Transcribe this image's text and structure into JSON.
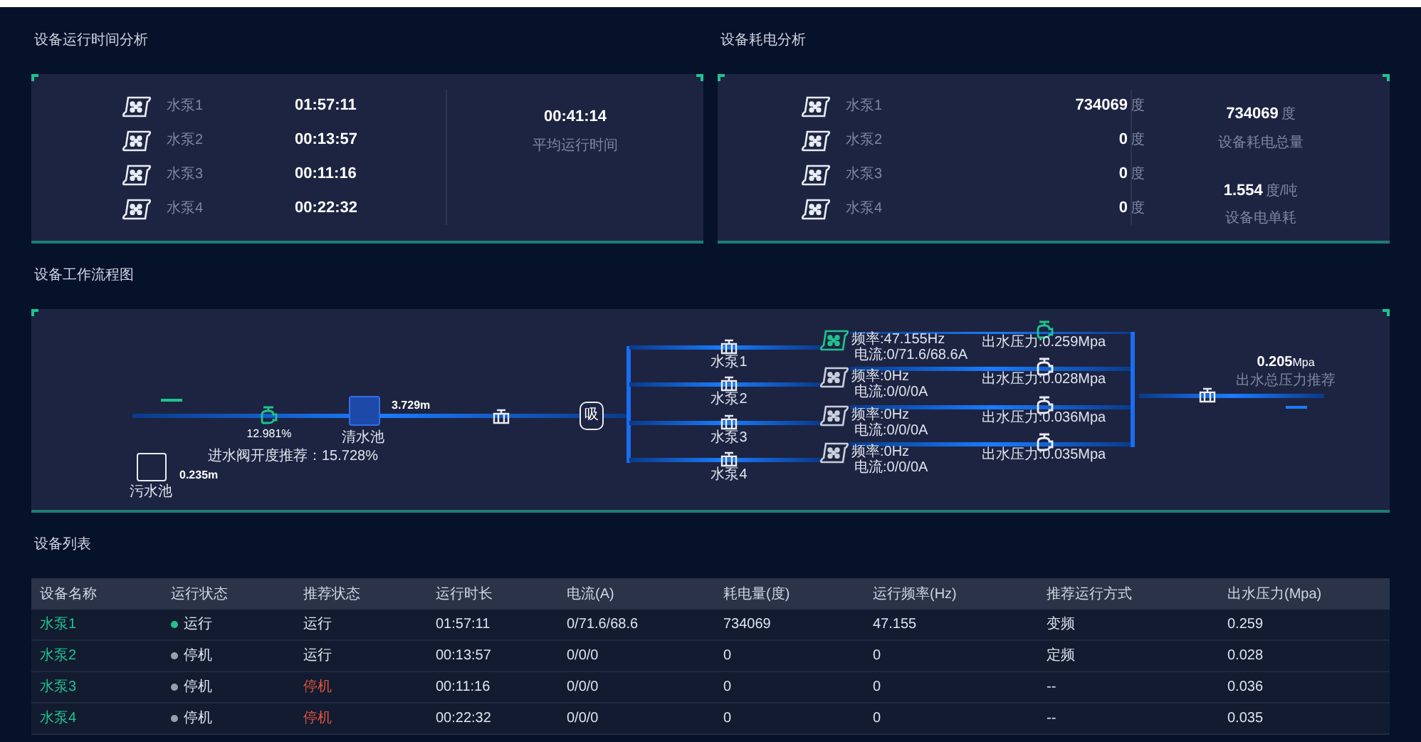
{
  "runtime_analysis": {
    "title": "设备运行时间分析",
    "items": [
      {
        "name": "水泵1",
        "value": "01:57:11"
      },
      {
        "name": "水泵2",
        "value": "00:13:57"
      },
      {
        "name": "水泵3",
        "value": "00:11:16"
      },
      {
        "name": "水泵4",
        "value": "00:22:32"
      }
    ],
    "summaries": [
      {
        "value": "00:41:14",
        "label": "平均运行时间"
      }
    ]
  },
  "power_analysis": {
    "title": "设备耗电分析",
    "items": [
      {
        "name": "水泵1",
        "value": "734069",
        "unit": "度"
      },
      {
        "name": "水泵2",
        "value": "0",
        "unit": "度"
      },
      {
        "name": "水泵3",
        "value": "0",
        "unit": "度"
      },
      {
        "name": "水泵4",
        "value": "0",
        "unit": "度"
      }
    ],
    "summaries": [
      {
        "value": "734069",
        "unit": "度",
        "label": "设备耗电总量"
      },
      {
        "value": "1.554",
        "unit": "度/吨",
        "label": "设备电单耗"
      }
    ]
  },
  "flow_diagram": {
    "title": "设备工作流程图",
    "inlet_valve": {
      "opening": "12.981%",
      "on": true
    },
    "clean_tank": {
      "name": "清水池",
      "level": "3.729m"
    },
    "suction_tank": {
      "label": "吸"
    },
    "sewage_tank": {
      "name": "污水池",
      "level": "0.235m"
    },
    "recommendation": "进水阀开度推荐：15.728%",
    "pumps": [
      {
        "name": "水泵1",
        "frequency": "频率:47.155Hz",
        "current": "电流:0/71.6/68.6A",
        "pressure": "出水压力:0.259Mpa",
        "on": true
      },
      {
        "name": "水泵2",
        "frequency": "频率:0Hz",
        "current": "电流:0/0/0A",
        "pressure": "出水压力:0.028Mpa",
        "on": false
      },
      {
        "name": "水泵3",
        "frequency": "频率:0Hz",
        "current": "电流:0/0/0A",
        "pressure": "出水压力:0.036Mpa",
        "on": false
      },
      {
        "name": "水泵4",
        "frequency": "频率:0Hz",
        "current": "电流:0/0/0A",
        "pressure": "出水压力:0.035Mpa",
        "on": false
      }
    ],
    "total_pressure": {
      "value": "0.205",
      "unit": "Mpa",
      "label": "出水总压力推荐"
    }
  },
  "device_list": {
    "title": "设备列表",
    "columns": [
      "设备名称",
      "运行状态",
      "推荐状态",
      "运行时长",
      "电流(A)",
      "耗电量(度)",
      "运行频率(Hz)",
      "推荐运行方式",
      "出水压力(Mpa)"
    ],
    "rows": [
      {
        "name": "水泵1",
        "status": {
          "text": "运行",
          "color": "#1fc48d"
        },
        "recommend": {
          "text": "运行",
          "kind": "run"
        },
        "runtime": "01:57:11",
        "current": "0/71.6/68.6",
        "power": "734069",
        "frequency": "47.155",
        "mode": "变频",
        "pressure": "0.259"
      },
      {
        "name": "水泵2",
        "status": {
          "text": "停机",
          "color": "#9aa0aa"
        },
        "recommend": {
          "text": "运行",
          "kind": "run"
        },
        "runtime": "00:13:57",
        "current": "0/0/0",
        "power": "0",
        "frequency": "0",
        "mode": "定频",
        "pressure": "0.028"
      },
      {
        "name": "水泵3",
        "status": {
          "text": "停机",
          "color": "#9aa0aa"
        },
        "recommend": {
          "text": "停机",
          "kind": "stop"
        },
        "runtime": "00:11:16",
        "current": "0/0/0",
        "power": "0",
        "frequency": "0",
        "mode": "--",
        "pressure": "0.036"
      },
      {
        "name": "水泵4",
        "status": {
          "text": "停机",
          "color": "#9aa0aa"
        },
        "recommend": {
          "text": "停机",
          "kind": "stop"
        },
        "runtime": "00:22:32",
        "current": "0/0/0",
        "power": "0",
        "frequency": "0",
        "mode": "--",
        "pressure": "0.035"
      }
    ]
  }
}
